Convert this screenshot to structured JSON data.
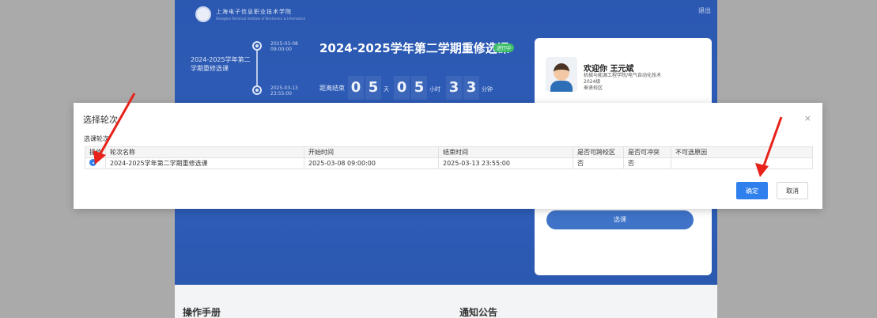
{
  "header": {
    "school_name": "上海电子信息职业技术学院",
    "school_sub": "Shanghai Technical Institute of Electronics & Information",
    "logout": "退出"
  },
  "timeline": {
    "round_name": "2024-2025学年第二学期重修选课",
    "start_date": "2025-03-08",
    "start_time": "09:00:00",
    "end_date": "2025-03-13",
    "end_time": "23:55:00"
  },
  "term": {
    "title": "2024-2025学年第二学期重修选课",
    "badge": "进行中",
    "countdown_label": "距离结束",
    "digits": [
      "0",
      "5",
      "0",
      "5",
      "3",
      "3"
    ],
    "units": {
      "day": "天",
      "hour": "小时",
      "minute": "分钟"
    }
  },
  "user": {
    "welcome": "欢迎你 王元斌",
    "college": "机械与能源工程学院/电气自动化技术",
    "grade": "2024级",
    "campus": "奉贤校区",
    "select_button": "选课"
  },
  "bottom": {
    "manual": "操作手册",
    "notice": "通知公告"
  },
  "modal": {
    "title": "选择轮次",
    "close": "×",
    "section_label": "选课轮次",
    "columns": [
      "操作",
      "轮次名称",
      "开始时间",
      "结束时间",
      "是否可跨校区",
      "是否可冲突",
      "不可选原因"
    ],
    "rows": [
      {
        "name": "2024-2025学年第二学期重修选课",
        "start": "2025-03-08 09:00:00",
        "end": "2025-03-13 23:55:00",
        "cross_campus": "否",
        "conflict": "否",
        "reason": ""
      }
    ],
    "confirm": "确定",
    "cancel": "取消"
  },
  "colors": {
    "overlay": "#aaaaaa",
    "brand_blue": "#2c59b0",
    "primary": "#2f80ed",
    "badge_green": "#3dbd6a",
    "annotation_red": "#e8221b"
  }
}
